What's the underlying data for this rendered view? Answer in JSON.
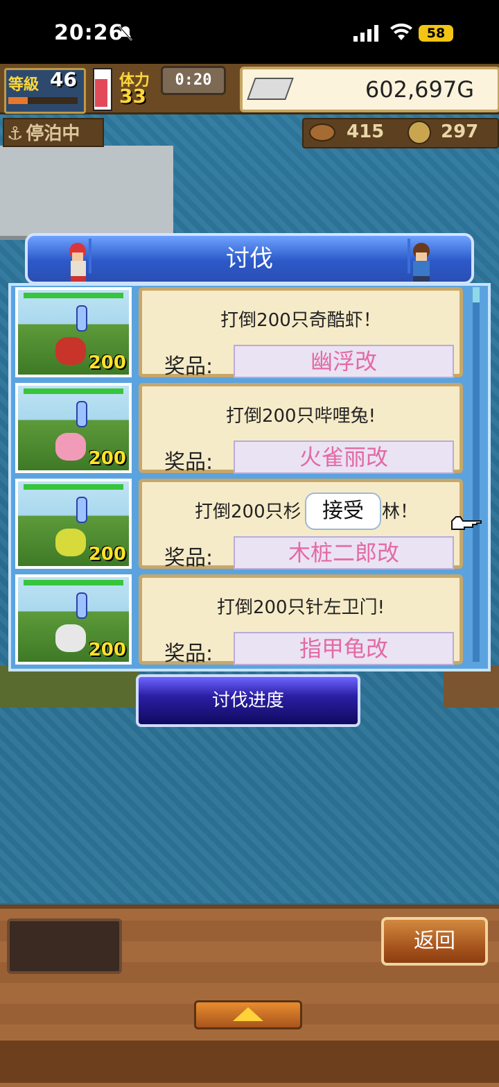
{
  "status_bar": {
    "time": "20:26",
    "battery": "58"
  },
  "hud": {
    "level_label": "等級",
    "level": "46",
    "stamina_label": "体力",
    "stamina": "33",
    "timer": "0:20",
    "gold": "602,697G",
    "status": "停泊中",
    "resource_1": "415",
    "resource_2": "297",
    "hp_fraction": 0.8,
    "xp_fraction": 0.28
  },
  "dialog": {
    "title": "讨伐",
    "reward_label": "奖品:",
    "quests": [
      {
        "title": "打倒200只奇酷虾！",
        "reward": "幽浮改",
        "count": "200",
        "monster_icon": "red-crab-icon",
        "monster_color": "#c8342a"
      },
      {
        "title": "打倒200只哔哩兔!",
        "reward": "火雀丽改",
        "count": "200",
        "monster_icon": "pink-rabbit-icon",
        "monster_color": "#f29bb8"
      },
      {
        "title": "打倒200只杉",
        "title_tail": "林！",
        "reward": "木桩二郎改",
        "count": "200",
        "monster_icon": "yellow-sprout-icon",
        "monster_color": "#d6da3a"
      },
      {
        "title": "打倒200只针左卫门!",
        "reward": "指甲龟改",
        "count": "200",
        "monster_icon": "hedgehog-icon",
        "monster_color": "#e7e7e7"
      }
    ],
    "accept_label": "接受",
    "progress_label": "讨伐进度"
  },
  "bottom_bar": {
    "back_label": "返回"
  },
  "colors": {
    "reward_text": "#e36aa3",
    "title_bar": "#2c59c9",
    "panel": "#5ba3df"
  }
}
